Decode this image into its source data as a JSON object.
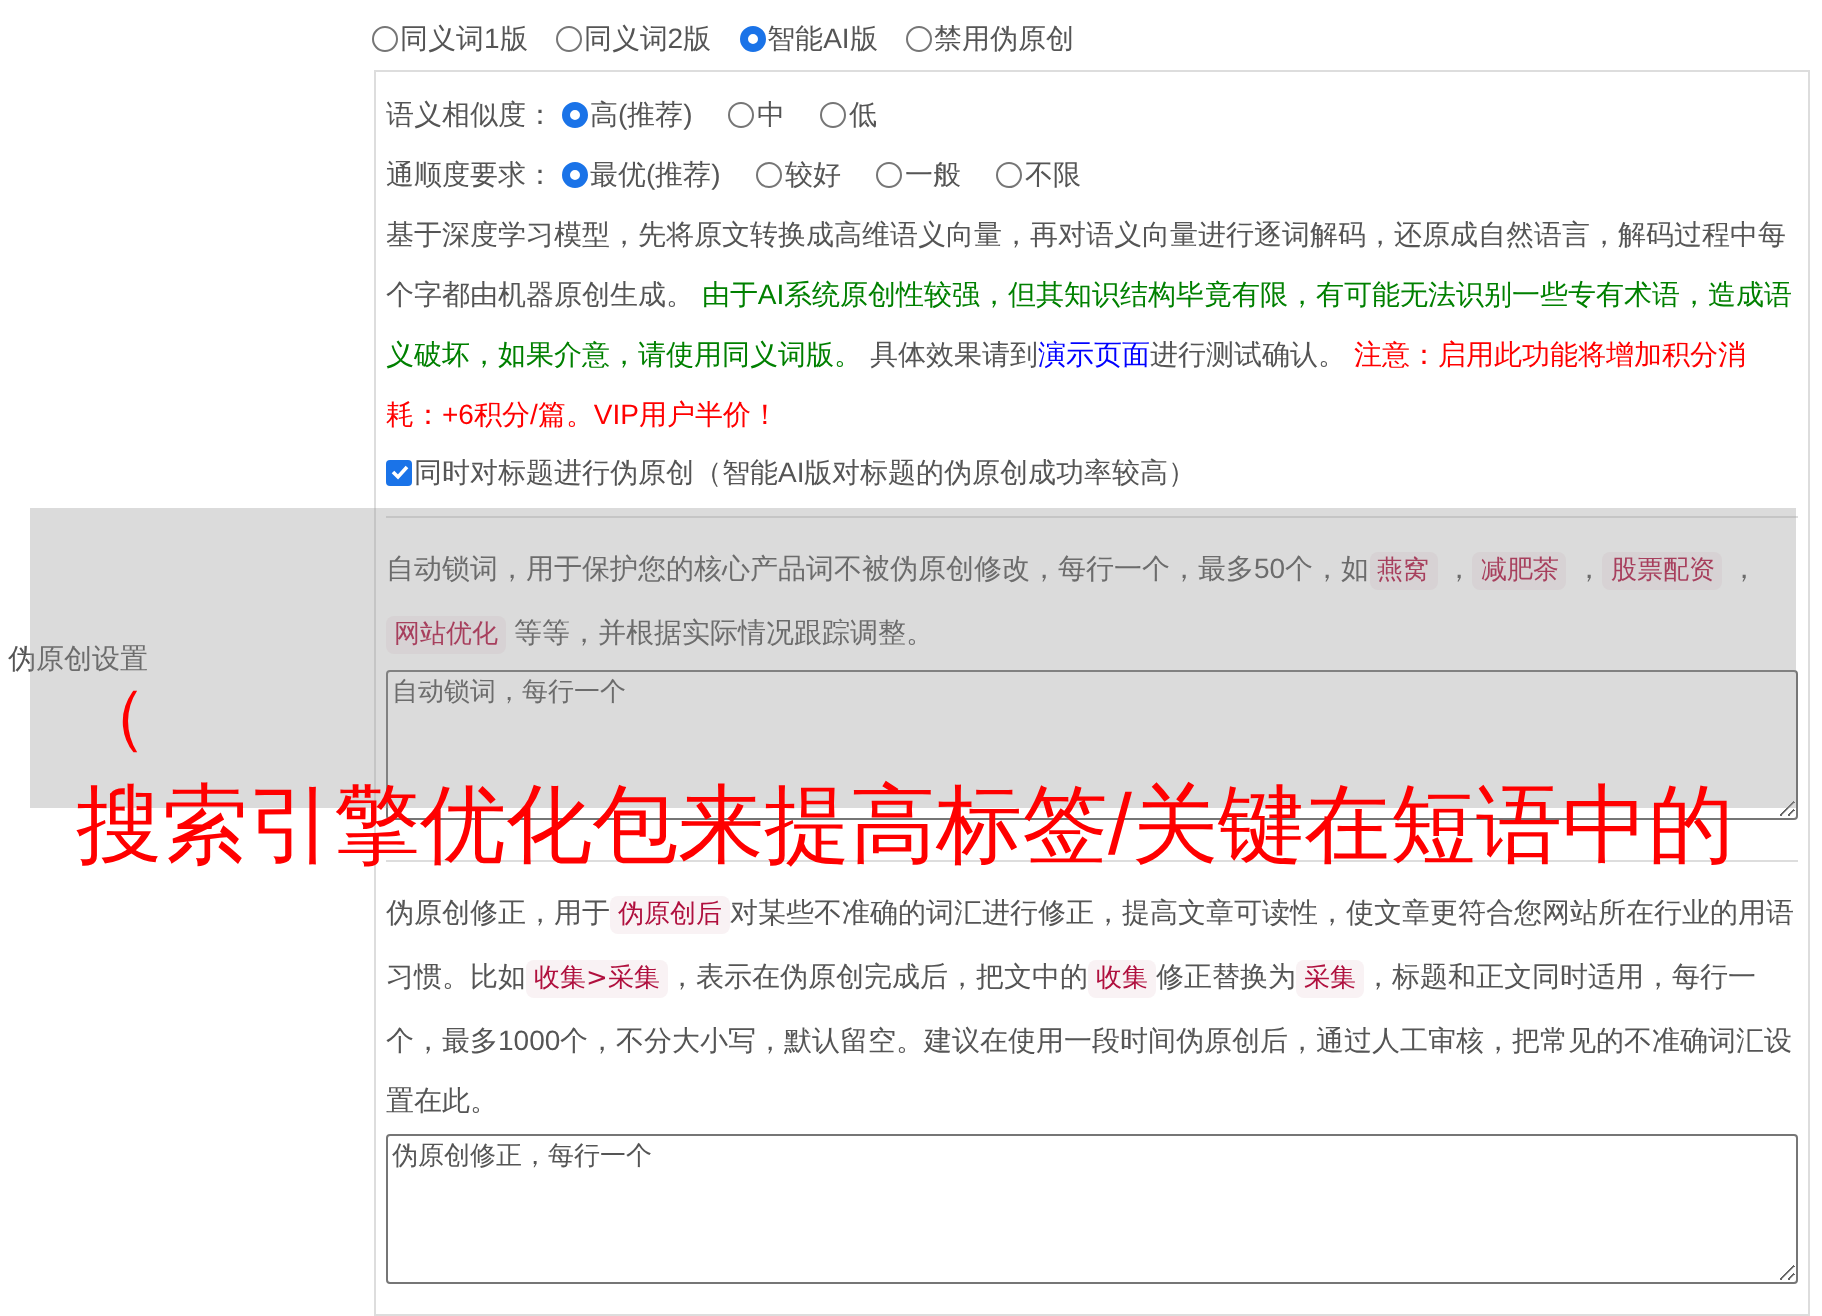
{
  "sidebar_label": "伪原创设置",
  "modes": [
    {
      "label": "同义词1版",
      "selected": false
    },
    {
      "label": "同义词2版",
      "selected": false
    },
    {
      "label": "智能AI版",
      "selected": true
    },
    {
      "label": "禁用伪原创",
      "selected": false
    }
  ],
  "settings": [
    {
      "label": "语义相似度：",
      "options": [
        {
          "label": "高(推荐)",
          "selected": true
        },
        {
          "label": "中",
          "selected": false
        },
        {
          "label": "低",
          "selected": false
        }
      ]
    },
    {
      "label": "通顺度要求：",
      "options": [
        {
          "label": "最优(推荐)",
          "selected": true
        },
        {
          "label": "较好",
          "selected": false
        },
        {
          "label": "一般",
          "selected": false
        },
        {
          "label": "不限",
          "selected": false
        }
      ]
    }
  ],
  "description": [
    {
      "kind": "plain",
      "text": "基于深度学习模型，先将原文转换成高维语义向量，再对语义向量进行逐词解码，还原成自然语言，解码过程中每个字都由机器原创生成。 "
    },
    {
      "kind": "green",
      "text": "由于AI系统原创性较强，但其知识结构毕竟有限，有可能无法识别一些专有术语，造成语义破坏，如果介意，请使用同义词版。"
    },
    {
      "kind": "plain",
      "text": " 具体效果请到"
    },
    {
      "kind": "link",
      "text": "演示页面"
    },
    {
      "kind": "plain",
      "text": "进行测试确认。 "
    },
    {
      "kind": "red",
      "text": "注意：启用此功能将增加积分消耗：+6积分/篇。VIP用户半价！"
    }
  ],
  "title_option": {
    "label": "同时对标题进行伪原创（智能AI版对标题的伪原创成功率较高）",
    "checked": true
  },
  "lock_words": {
    "description": [
      {
        "kind": "plain",
        "text": "自动锁词，用于保护您的核心产品词不被伪原创修改，每行一个，最多50个，如"
      },
      {
        "kind": "tag",
        "text": "燕窝"
      },
      {
        "kind": "plain",
        "text": " ，"
      },
      {
        "kind": "tag",
        "text": "减肥茶"
      },
      {
        "kind": "plain",
        "text": " ，"
      },
      {
        "kind": "tag",
        "text": "股票配资"
      },
      {
        "kind": "plain",
        "text": " ，"
      },
      {
        "kind": "tag",
        "text": "网站优化"
      },
      {
        "kind": "plain",
        "text": " 等等，并根据实际情况跟踪调整。"
      }
    ],
    "placeholder": "自动锁词，每行一个"
  },
  "correction": {
    "description": [
      {
        "kind": "plain",
        "text": "伪原创修正，用于"
      },
      {
        "kind": "tag",
        "text": "伪原创后"
      },
      {
        "kind": "plain",
        "text": "对某些不准确的词汇进行修正，提高文章可读性，使文章更符合您网站所在行业的用语习惯。比如"
      },
      {
        "kind": "tag",
        "text": "收集>采集"
      },
      {
        "kind": "plain",
        "text": "，表示在伪原创完成后，把文中的"
      },
      {
        "kind": "tag",
        "text": "收集"
      },
      {
        "kind": "plain",
        "text": "修正替换为"
      },
      {
        "kind": "tag",
        "text": "采集"
      },
      {
        "kind": "plain",
        "text": "，标题和正文同时适用，每行一个，最多1000个，不分大小写，默认留空。建议在使用一段时间伪原创后，通过人工审核，把常见的不准确词汇设置在此。"
      }
    ],
    "placeholder": "伪原创修正，每行一个"
  },
  "overlay": {
    "bracket": "（",
    "headline": "搜索引擎优化包来提高标签/关键在短语中的"
  }
}
